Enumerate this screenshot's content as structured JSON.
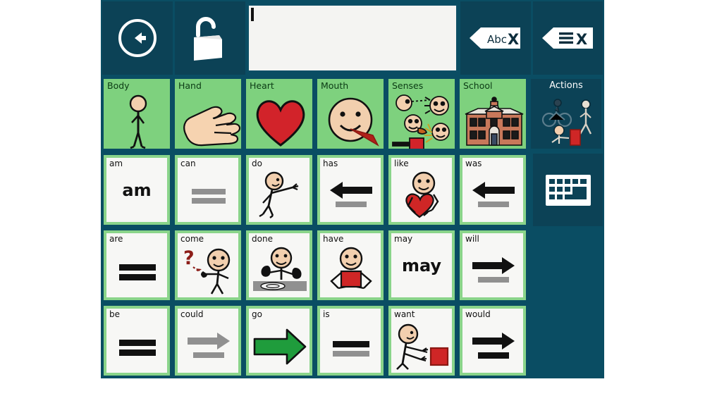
{
  "app": {
    "name": "aac-communication-board",
    "colors": {
      "panel_teal": "#0a4d63",
      "button_teal": "#0c4256",
      "category_green": "#7ed17e",
      "word_border_green": "#8ad48a",
      "cell_white": "#f7f7f5",
      "message_bar": "#f4f4f2",
      "heart_red": "#d2232a",
      "go_arrow_green": "#1f9c3c",
      "skin": "#f2cfae",
      "gray_bar": "#909090",
      "black_bar": "#111111"
    }
  },
  "toolbar": {
    "back_label": "Back",
    "back_icon": "circle-left-arrow-icon",
    "lock_label": "Unlock",
    "lock_icon": "open-padlock-icon",
    "message_bar": {
      "value": "",
      "placeholder": ""
    },
    "delete_letter_label": "Abc",
    "delete_letter_x": "X",
    "delete_letter_icon": "delete-letter-icon",
    "delete_all_label": "",
    "delete_all_x": "X",
    "delete_all_icon": "delete-all-icon"
  },
  "categories": [
    {
      "label": "Body",
      "icon": "stick-figure-body-icon",
      "selected": false
    },
    {
      "label": "Hand",
      "icon": "open-hand-icon",
      "selected": false
    },
    {
      "label": "Heart",
      "icon": "red-heart-icon",
      "selected": false
    },
    {
      "label": "Mouth",
      "icon": "smiling-face-mouth-icon",
      "selected": false
    },
    {
      "label": "Senses",
      "icon": "five-senses-faces-icon",
      "selected": false
    },
    {
      "label": "School",
      "icon": "school-building-icon",
      "selected": false
    },
    {
      "label": "Actions",
      "icon": "actions-figures-icon",
      "selected": true
    }
  ],
  "keyboard_button": {
    "label": "Keyboard",
    "icon": "keyboard-icon"
  },
  "words": [
    [
      {
        "label": "am",
        "art": "bigword",
        "text": "am"
      },
      {
        "label": "can",
        "art": "two-gray-bars"
      },
      {
        "label": "do",
        "art": "stick-figure-pointing-icon"
      },
      {
        "label": "has",
        "art": "black-left-arrow-gray-bar"
      },
      {
        "label": "like",
        "art": "figure-hugging-heart-icon"
      },
      {
        "label": "was",
        "art": "black-left-arrow-gray-bar"
      }
    ],
    [
      {
        "label": "are",
        "art": "two-black-bars"
      },
      {
        "label": "come",
        "art": "figure-beckoning-question-icon"
      },
      {
        "label": "done",
        "art": "figure-hands-up-table-icon"
      },
      {
        "label": "have",
        "art": "figure-holding-red-box-icon"
      },
      {
        "label": "may",
        "art": "bigword",
        "text": "may"
      },
      {
        "label": "will",
        "art": "black-right-arrow-gray-bar"
      }
    ],
    [
      {
        "label": "be",
        "art": "two-black-bars"
      },
      {
        "label": "could",
        "art": "gray-right-arrow-gray-bar"
      },
      {
        "label": "go",
        "art": "green-right-arrow-icon"
      },
      {
        "label": "is",
        "art": "black-bar-gray-bar"
      },
      {
        "label": "want",
        "art": "figure-reaching-red-box-icon"
      },
      {
        "label": "would",
        "art": "black-right-arrow-black-bar"
      }
    ]
  ]
}
